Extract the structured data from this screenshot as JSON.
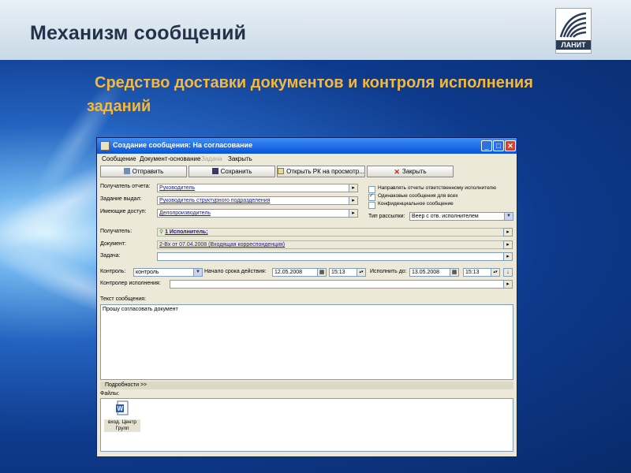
{
  "slide": {
    "title": "Механизм сообщений",
    "subtitle": "Средство доставки документов и контроля исполнения заданий",
    "logo_text": "ЛАНИТ"
  },
  "window": {
    "title": "Создание сообщения: На согласование",
    "menu": [
      "Сообщение",
      "Документ-основание",
      "Задача",
      "Закрыть"
    ],
    "toolbar": {
      "send": "Отправить",
      "save": "Сохранить",
      "open_rk": "Открыть РК на просмотр...",
      "close": "Закрыть"
    },
    "form": {
      "report_recipient_label": "Получатель отчета:",
      "report_recipient_value": "Руководитель",
      "task_issued_label": "Задание выдал:",
      "task_issued_value": "Руководитель структурного подразделения",
      "access_label": "Имеющие доступ:",
      "access_value": "Делопроизводитель",
      "opt_send_reports": "Направлять отчеты ответственному исполнителю",
      "opt_same_messages": "Одинаковые сообщения для всех",
      "opt_confidential": "Конфиденциальное сообщение",
      "mailing_type_label": "Тип рассылки:",
      "mailing_type_value": "Веер с отв. исполнителем",
      "recipient_label": "Получатель:",
      "recipient_value": "1 Исполнитель;",
      "document_label": "Документ:",
      "document_value": "2-Вх от 07.04.2008 (Входящая корреспонденция)",
      "task_label": "Задача:",
      "task_value": "",
      "control_label": "Контроль:",
      "control_value": "контроль",
      "start_label": "Начало срока действия:",
      "start_date": "12.05.2008",
      "start_time": "15:13",
      "due_label": "Исполнить до:",
      "due_date": "13.05.2008",
      "due_time": "15:13",
      "controller_label": "Контролер исполнения:",
      "controller_value": "",
      "message_label": "Текст сообщения:",
      "message_text": "Прошу согласовать документ",
      "details": "Подробности >>",
      "files_label": "Файлы:",
      "file_name": "вход. Центр Групп"
    }
  },
  "colors": {
    "slide_header": "#dde7ef",
    "subtitle": "#f5b83a",
    "titlebar": "#0a54d8",
    "window_bg": "#ece9d8"
  }
}
